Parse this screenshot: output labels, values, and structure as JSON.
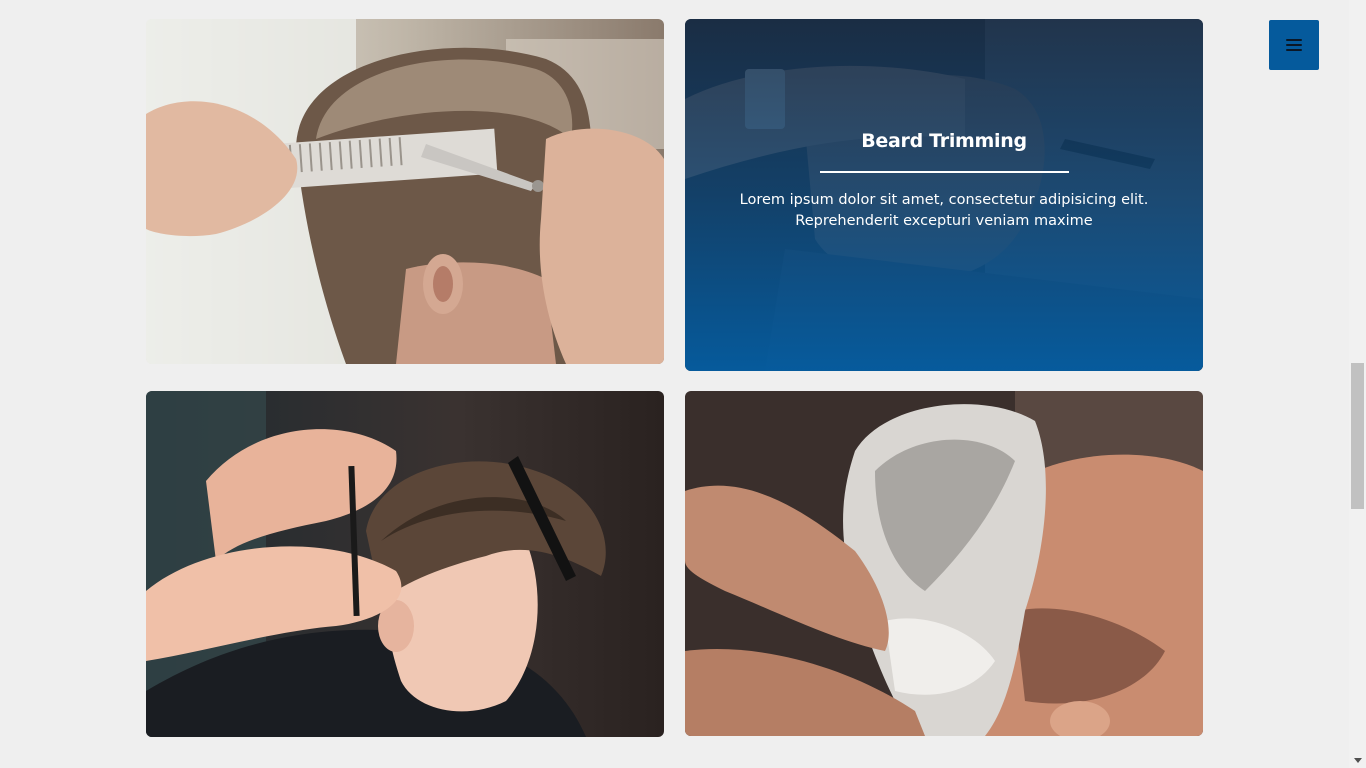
{
  "services": [
    {
      "name": "haircut-photo"
    },
    {
      "title": "Beard Trimming",
      "description": "Lorem ipsum dolor sit amet, consectetur adipisicing elit. Reprehenderit excepturi veniam maxime"
    },
    {
      "name": "kids-haircut-photo"
    },
    {
      "name": "hair-wash-photo"
    }
  ],
  "colors": {
    "accent": "#055a9c",
    "page_bg": "#efefef"
  },
  "menu_icon": "hamburger-menu-icon"
}
